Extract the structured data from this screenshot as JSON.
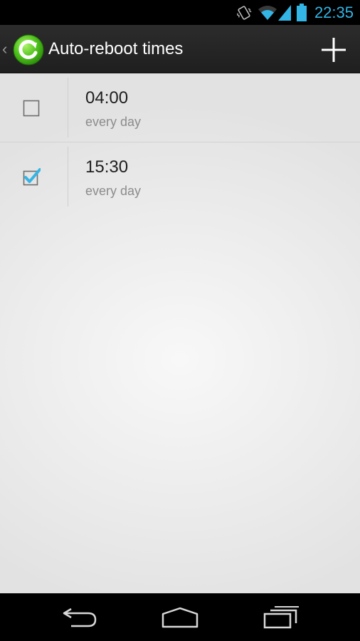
{
  "status_bar": {
    "time": "22:35",
    "accent_color": "#33b5e5",
    "icons": [
      "vibrate-icon",
      "wifi-icon",
      "signal-icon",
      "battery-icon"
    ]
  },
  "action_bar": {
    "title": "Auto-reboot times",
    "up_caret": "‹",
    "app_icon": "refresh-app-icon",
    "add_icon": "plus-icon"
  },
  "reboot_times": [
    {
      "time": "04:00",
      "repeat": "every day",
      "enabled": false
    },
    {
      "time": "15:30",
      "repeat": "every day",
      "enabled": true
    }
  ],
  "nav_bar": {
    "icons": [
      "back-icon",
      "home-icon",
      "recent-apps-icon"
    ]
  }
}
